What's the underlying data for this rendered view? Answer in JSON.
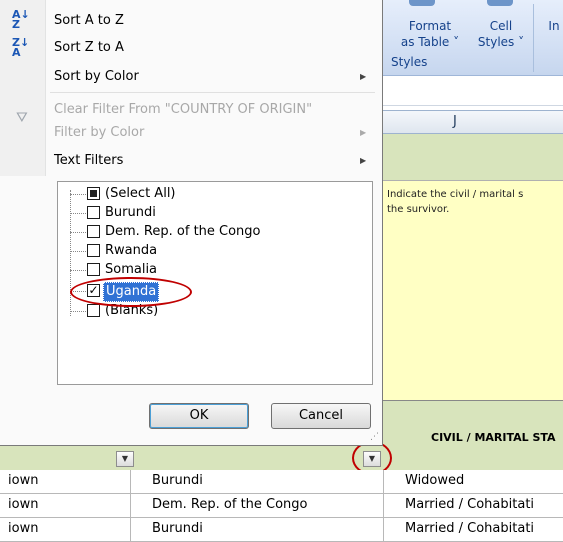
{
  "menu": {
    "sort_az": "Sort A to Z",
    "sort_za": "Sort Z to A",
    "sort_by_color": "Sort by Color",
    "clear_filter": "Clear Filter From \"COUNTRY OF ORIGIN\"",
    "filter_by_color": "Filter by Color",
    "text_filters": "Text Filters"
  },
  "filter_list": {
    "items": [
      {
        "label": "(Select All)",
        "state": "partial"
      },
      {
        "label": "Burundi",
        "state": "unchecked"
      },
      {
        "label": "Dem. Rep. of the Congo",
        "state": "unchecked"
      },
      {
        "label": "Rwanda",
        "state": "unchecked"
      },
      {
        "label": "Somalia",
        "state": "unchecked"
      },
      {
        "label": "Uganda",
        "state": "checked",
        "selected": true
      },
      {
        "label": "(Blanks)",
        "state": "unchecked"
      }
    ]
  },
  "buttons": {
    "ok": "OK",
    "cancel": "Cancel"
  },
  "ribbon": {
    "format_line1": "Format",
    "format_line2": "as Table ˅",
    "cell_line1": "Cell",
    "cell_line2": "Styles ˅",
    "insert_partial": "In",
    "group_label": "Styles"
  },
  "sheet": {
    "column_letter": "J",
    "instruction_line1": "Indicate the civil / marital s",
    "instruction_line2": "the survivor.",
    "header_right": "CIVIL / MARITAL STA",
    "rows": [
      {
        "col_a": "iown",
        "col_b": "Burundi",
        "col_c": "Widowed"
      },
      {
        "col_a": "iown",
        "col_b": "Dem. Rep. of the Congo",
        "col_c": "Married / Cohabitati"
      },
      {
        "col_a": "iown",
        "col_b": "Burundi",
        "col_c": "Married / Cohabitati"
      }
    ]
  },
  "colors": {
    "highlight": "#3072d4",
    "annotation_red": "#c00000",
    "header_green": "#d8e4bc",
    "instruction_yellow": "#ffffc4"
  }
}
